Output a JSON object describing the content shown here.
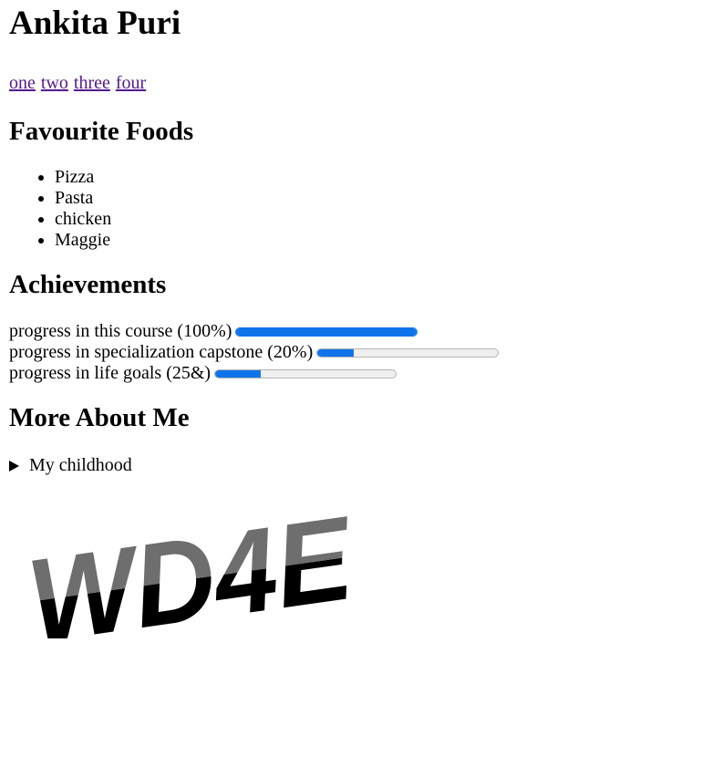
{
  "header": {
    "title": "Ankita Puri"
  },
  "nav": {
    "links": [
      "one",
      "two",
      "three",
      "four"
    ]
  },
  "foods": {
    "heading": "Favourite Foods",
    "items": [
      "Pizza",
      "Pasta",
      "chicken",
      "Maggie"
    ]
  },
  "achievements": {
    "heading": "Achievements",
    "items": [
      {
        "label": "progress in this course (100%)",
        "value": 1.0
      },
      {
        "label": "progress in specialization capstone (20%)",
        "value": 0.2
      },
      {
        "label": "progress in life goals (25&)",
        "value": 0.25
      }
    ]
  },
  "more": {
    "heading": "More About Me",
    "summary": "My childhood"
  },
  "logo": {
    "text": "WD4E"
  },
  "colors": {
    "progress_fill": "#0f74ea",
    "link": "#551a8b"
  }
}
